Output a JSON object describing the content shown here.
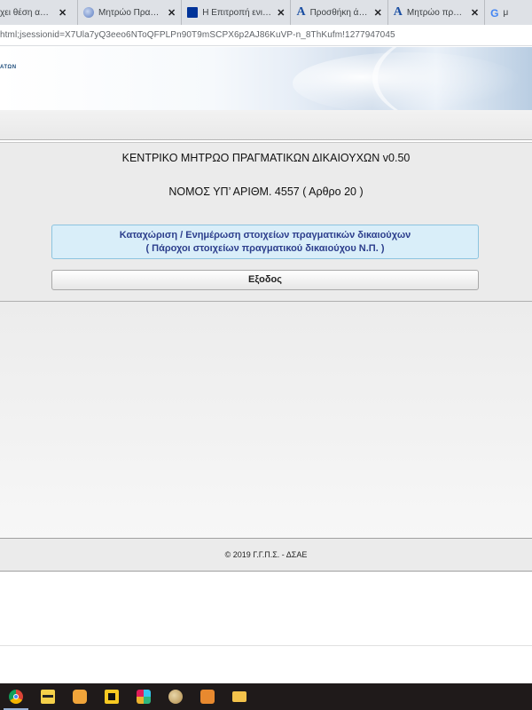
{
  "browser": {
    "tabs": [
      {
        "title": "χει θέση απόδε",
        "icon": "document-icon"
      },
      {
        "title": "Μητρώο Πραγματ",
        "icon": "globe-icon"
      },
      {
        "title": "Η Επιτροπή ενισχύ",
        "icon": "eu-flag-icon"
      },
      {
        "title": "Προσθήκη άρθρου",
        "icon": "letter-a-icon"
      },
      {
        "title": "Μητρώο πραγματι",
        "icon": "letter-a-icon"
      },
      {
        "title": "μ",
        "icon": "google-icon"
      }
    ],
    "close_glyph": "✕",
    "url": "html;jsessionid=X7Ula7yQ3eeo6NToQFPLPn90T9mSCPX6p2AJ86KuVP-n_8ThKufm!1277947045"
  },
  "banner": {
    "logo_text": "ΑΤΩΝ"
  },
  "main": {
    "title": "ΚΕΝΤΡΙΚΟ ΜΗΤΡΩΟ ΠΡΑΓΜΑΤΙΚΩΝ ΔΙΚΑΙΟΥΧΩΝ v0.50",
    "subtitle": "ΝΟΜΟΣ ΥΠ’ ΑΡΙΘΜ. 4557 ( Αρθρο 20 )",
    "register_button_line1": "Καταχώριση / Ενημέρωση στοιχείων πραγματικών δικαιούχων",
    "register_button_line2": "( Πάροχοι στοιχείων πραγματικού δικαιούχου Ν.Π. )",
    "exit_button": "Εξοδος"
  },
  "footer": {
    "copyright": "© 2019 Γ.Γ.Π.Σ. - ΔΣΑΕ"
  },
  "taskbar": {
    "icons": [
      "chrome-icon",
      "file-manager-icon",
      "puzzle-icon",
      "sticky-app-icon",
      "slack-icon",
      "globe-app-icon",
      "chat-icon",
      "folder-icon"
    ]
  }
}
